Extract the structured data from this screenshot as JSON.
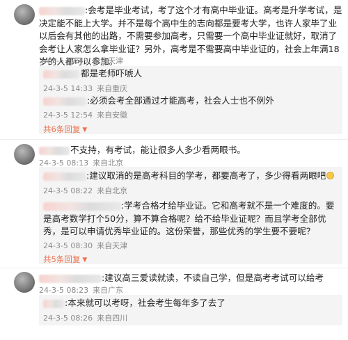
{
  "comments": [
    {
      "text": ":会考是毕业考试，考了这个才有高中毕业证。高考是升学考试，是决定能不能上大学。并不是每个高中生的志向都是要考大学，也许人家毕了业以后会有其他的出路，不需要参加高考，只需要一个高中毕业证就好，取消了会考让人家怎么拿毕业证？另外，高考是不需要高中毕业证的，社会上年满18岁的人都可以参加。",
      "date": "24-3-5 09:49",
      "source": "来自天津",
      "replies": [
        {
          "text": "都是老师吓唬人",
          "date": "24-3-5 14:33",
          "source": "来自重庆"
        },
        {
          "text": ":必须会考全部通过才能高考，社会人士也不例外",
          "date": "24-3-5 12:54",
          "source": "来自安徽"
        }
      ],
      "more": "共6条回复"
    },
    {
      "text": "不支持，有考试，能让很多人多少看两眼书。",
      "date": "24-3-5 08:13",
      "source": "来自北京",
      "replies": [
        {
          "text": ":建议取消的是高考科目的学考，都要高考了，多少得看两眼吧",
          "date": "24-3-5 08:22",
          "source": "来自北京"
        },
        {
          "text": ":学考合格才给毕业证。它和高考就不是一个难度的。要是高考数学打个50分，算不算合格呢？给不给毕业证呢？而且学考全部优秀，是可以申请优秀毕业证的。这份荣誉，那些优秀的学生要不要呢？",
          "date": "24-3-5 08:30",
          "source": "来自天津"
        }
      ],
      "more": "共5条回复"
    },
    {
      "text": ":建议高三爱读就读，不读自己学，但是高考考试可以给考",
      "date": "24-3-5 08:23",
      "source": "来自广东",
      "replies": [
        {
          "text": "本来就可以考呀，社会考生每年多了去了",
          "date": "24-3-5 08:26",
          "source": "来自四川"
        }
      ]
    }
  ]
}
